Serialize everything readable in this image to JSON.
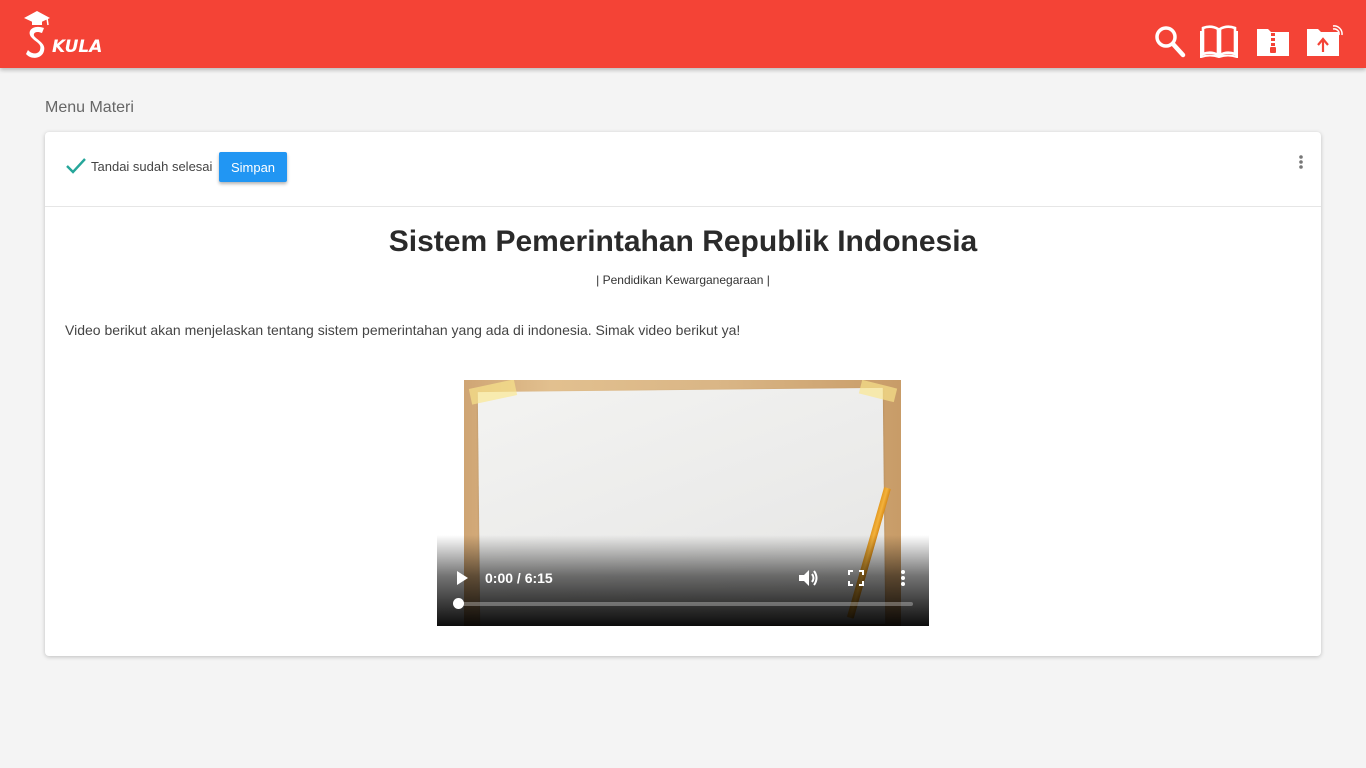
{
  "app": {
    "logo_text": "KULA",
    "brand_color": "#f44336",
    "icons": [
      "search-icon",
      "book-icon",
      "zipper-folder-icon",
      "upload-folder-icon"
    ]
  },
  "breadcrumb": "Menu Materi",
  "toolbar": {
    "mark_done_label": "Tandai sudah selesai",
    "save_label": "Simpan"
  },
  "material": {
    "title": "Sistem Pemerintahan Republik Indonesia",
    "subject": "| Pendidikan Kewarganegaraan |",
    "description": "Video berikut akan menjelaskan tentang sistem pemerintahan yang ada di indonesia. Simak video berikut ya!"
  },
  "video": {
    "time": "0:00 / 6:15",
    "progress": 0
  }
}
